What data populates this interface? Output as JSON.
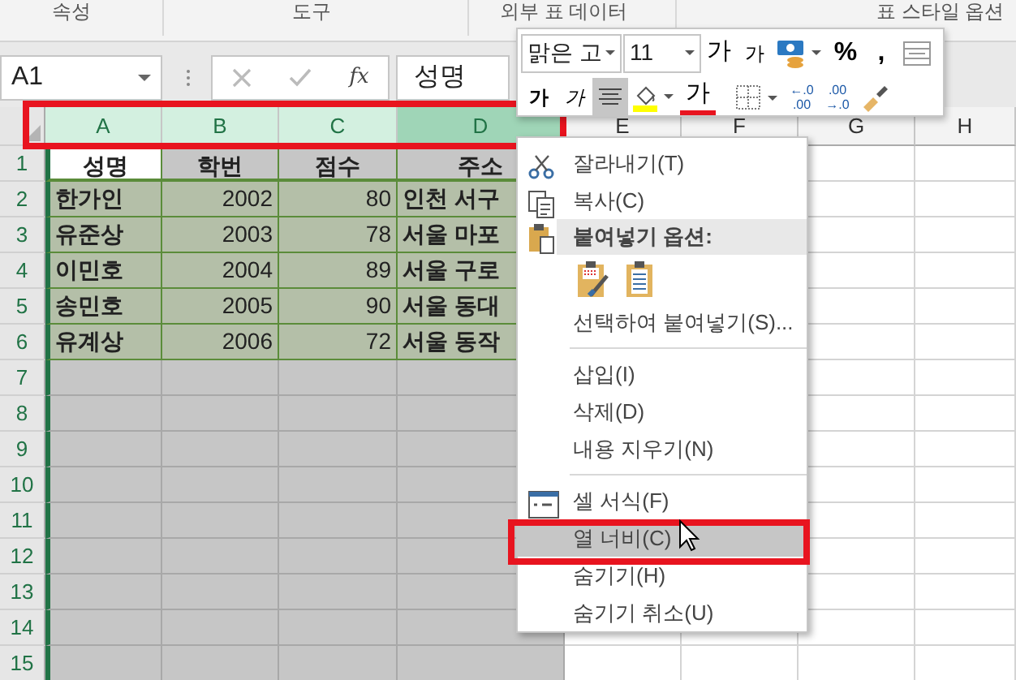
{
  "ribbon": {
    "groups": [
      "속성",
      "도구",
      "외부 표 데이터",
      "표 스타일 옵션"
    ]
  },
  "formula_bar": {
    "name_box": "A1",
    "function_label": "fx",
    "value": "성명"
  },
  "mini_toolbar": {
    "font": "맑은 고",
    "size": "11",
    "row_1": [
      {
        "kind": "grow",
        "label": "가",
        "selected": false
      },
      {
        "kind": "shrink",
        "label": "가",
        "selected": false
      },
      {
        "kind": "money",
        "selected": false
      },
      {
        "kind": "text",
        "label": "%",
        "selected": false
      },
      {
        "kind": "text",
        "label": ",",
        "selected": false
      },
      {
        "kind": "merge",
        "selected": false
      }
    ],
    "row_2": [
      {
        "kind": "bold",
        "label": "가",
        "selected": false
      },
      {
        "kind": "italic",
        "label": "가",
        "selected": false
      },
      {
        "kind": "align",
        "selected": true
      },
      {
        "kind": "fill",
        "selected": false
      },
      {
        "kind": "font_color",
        "label": "가",
        "selected": false
      },
      {
        "kind": "borders",
        "selected": false
      },
      {
        "kind": "decimal",
        "top": "←.0",
        "bottom": ".00",
        "selected": false
      },
      {
        "kind": "decimal",
        "top": ".00",
        "bottom": "→.0",
        "selected": false
      },
      {
        "kind": "painter",
        "selected": false
      }
    ]
  },
  "sheet": {
    "columns": [
      {
        "label": "A",
        "selected": true,
        "hovered": false
      },
      {
        "label": "B",
        "selected": true,
        "hovered": false
      },
      {
        "label": "C",
        "selected": true,
        "hovered": false
      },
      {
        "label": "D",
        "selected": true,
        "hovered": true
      },
      {
        "label": "E",
        "selected": false,
        "hovered": false
      },
      {
        "label": "F",
        "selected": false,
        "hovered": false
      },
      {
        "label": "G",
        "selected": false,
        "hovered": false
      },
      {
        "label": "H",
        "selected": false,
        "hovered": false
      }
    ],
    "rows": [
      "1",
      "2",
      "3",
      "4",
      "5",
      "6",
      "7",
      "8",
      "9",
      "10",
      "11",
      "12",
      "13",
      "14",
      "15"
    ]
  },
  "table": {
    "columns": [
      {
        "heading": "성명",
        "kind": "text",
        "active": true
      },
      {
        "heading": "학번",
        "kind": "number",
        "active": false
      },
      {
        "heading": "점수",
        "kind": "number",
        "active": false
      },
      {
        "heading": "주소",
        "kind": "text",
        "active": false
      }
    ],
    "rows": [
      [
        "한가인",
        "2002",
        "80",
        "인천 서구"
      ],
      [
        "유준상",
        "2003",
        "78",
        "서울 마포"
      ],
      [
        "이민호",
        "2004",
        "89",
        "서울 구로"
      ],
      [
        "송민호",
        "2005",
        "90",
        "서울 동대"
      ],
      [
        "유계상",
        "2006",
        "72",
        "서울 동작"
      ]
    ]
  },
  "context_menu": [
    {
      "kind": "cut",
      "label": "잘라내기(T)",
      "selected": false
    },
    {
      "kind": "copy",
      "label": "복사(C)",
      "selected": false
    },
    {
      "kind": "header",
      "label": "붙여넣기 옵션:"
    },
    {
      "kind": "paste_icons"
    },
    {
      "kind": "item",
      "label": "선택하여 붙여넣기(S)...",
      "selected": false
    },
    {
      "kind": "separator"
    },
    {
      "kind": "item",
      "label": "삽입(I)",
      "selected": false
    },
    {
      "kind": "item",
      "label": "삭제(D)",
      "selected": false
    },
    {
      "kind": "item",
      "label": "내용 지우기(N)",
      "selected": false
    },
    {
      "kind": "separator"
    },
    {
      "kind": "format",
      "label": "셀 서식(F)",
      "selected": false
    },
    {
      "kind": "item",
      "label": "열 너비(C)",
      "selected": true
    },
    {
      "kind": "item",
      "label": "숨기기(H)",
      "selected": false
    },
    {
      "kind": "item",
      "label": "숨기기 취소(U)",
      "selected": false
    }
  ]
}
